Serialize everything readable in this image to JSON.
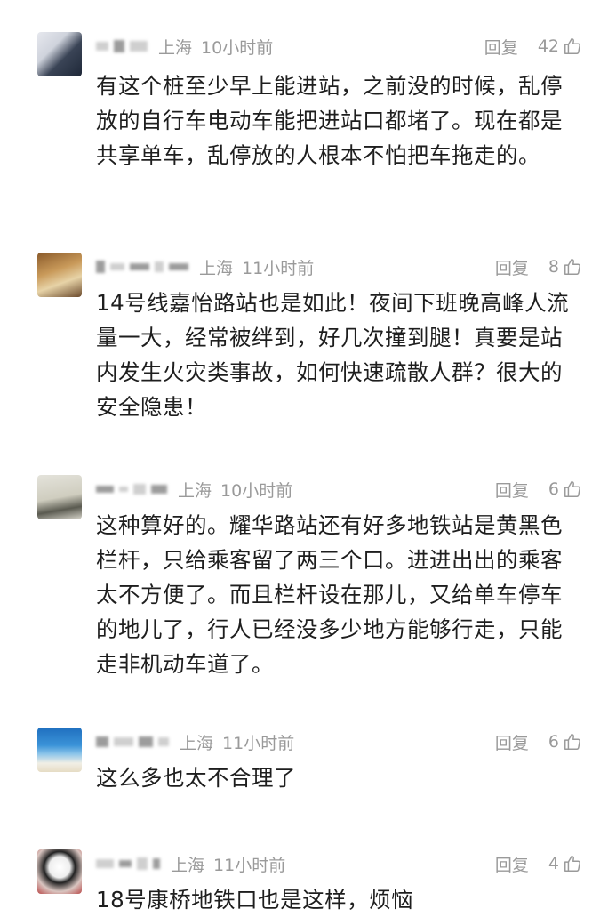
{
  "comments": [
    {
      "location": "上海",
      "time": "10小时前",
      "reply_label": "回复",
      "likes": "42",
      "text": "有这个桩至少早上能进站，之前没的时候，乱停放的自行车电动车能把进站口都堵了。现在都是共享单车，乱停放的人根本不怕把车拖走的。"
    },
    {
      "location": "上海",
      "time": "11小时前",
      "reply_label": "回复",
      "likes": "8",
      "text": "14号线嘉怡路站也是如此！夜间下班晚高峰人流量一大，经常被绊到，好几次撞到腿！真要是站内发生火灾类事故，如何快速疏散人群？很大的安全隐患！"
    },
    {
      "location": "上海",
      "time": "10小时前",
      "reply_label": "回复",
      "likes": "6",
      "text": "这种算好的。耀华路站还有好多地铁站是黄黑色栏杆，只给乘客留了两三个口。进进出出的乘客太不方便了。而且栏杆设在那儿，又给单车停车的地儿了，行人已经没多少地方能够行走，只能走非机动车道了。"
    },
    {
      "location": "上海",
      "time": "11小时前",
      "reply_label": "回复",
      "likes": "6",
      "text": "这么多也太不合理了"
    },
    {
      "location": "上海",
      "time": "11小时前",
      "reply_label": "回复",
      "likes": "4",
      "text": "18号康桥地铁口也是这样，烦恼"
    }
  ],
  "icons": {
    "like": "thumbs-up-icon"
  },
  "colors": {
    "meta": "#9a9a9a",
    "text": "#1e1e1e"
  }
}
